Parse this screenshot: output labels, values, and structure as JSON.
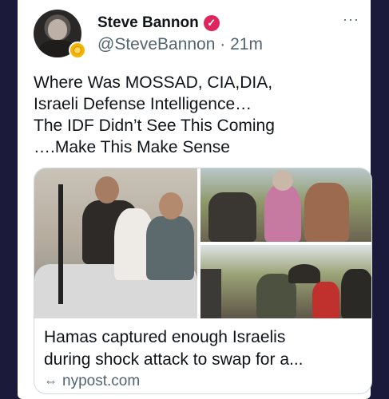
{
  "tweet": {
    "author_name": "Steve Bannon",
    "verified_mark": "✓",
    "handle_time": "@SteveBannon · 21m",
    "more_icon": "···",
    "text_lines": [
      "Where Was MOSSAD, CIA,DIA,",
      "Israeli Defense Intelligence…",
      "The IDF Didn’t See This Coming",
      "….Make This Make Sense"
    ]
  },
  "link_card": {
    "title_lines": [
      "Hamas captured enough Israelis",
      "during shock attack to swap for a..."
    ],
    "domain": "nypost.com",
    "link_icon": "⇔"
  },
  "colors": {
    "background": "#1c1a3a",
    "verified": "#e0245e",
    "secondary_text": "#536471"
  }
}
